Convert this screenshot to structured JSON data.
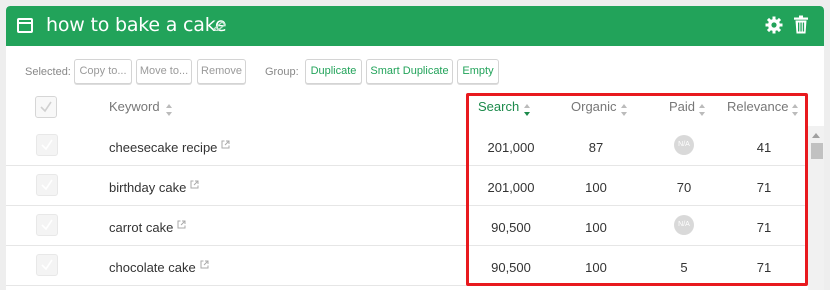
{
  "header": {
    "title": "how to bake a cake",
    "accent_color": "#22a35a",
    "icons": [
      "window-icon",
      "edit-icon",
      "gear-icon",
      "trash-icon"
    ]
  },
  "toolbar": {
    "selected_label": "Selected:",
    "copy_label": "Copy to...",
    "move_label": "Move to...",
    "remove_label": "Remove",
    "group_label": "Group:",
    "duplicate_label": "Duplicate",
    "smart_duplicate_label": "Smart Duplicate",
    "empty_label": "Empty"
  },
  "table": {
    "columns": {
      "keyword": "Keyword",
      "search": "Search",
      "organic": "Organic",
      "paid": "Paid",
      "relevance": "Relevance"
    },
    "sorted_column": "Search",
    "na_label": "N/A",
    "rows": [
      {
        "keyword": "cheesecake recipe",
        "search": "201,000",
        "organic": "87",
        "paid": "N/A",
        "relevance": "41"
      },
      {
        "keyword": "birthday cake",
        "search": "201,000",
        "organic": "100",
        "paid": "70",
        "relevance": "71"
      },
      {
        "keyword": "carrot cake",
        "search": "90,500",
        "organic": "100",
        "paid": "N/A",
        "relevance": "71"
      },
      {
        "keyword": "chocolate cake",
        "search": "90,500",
        "organic": "100",
        "paid": "5",
        "relevance": "71"
      }
    ]
  },
  "highlight_color": "#e8191e"
}
